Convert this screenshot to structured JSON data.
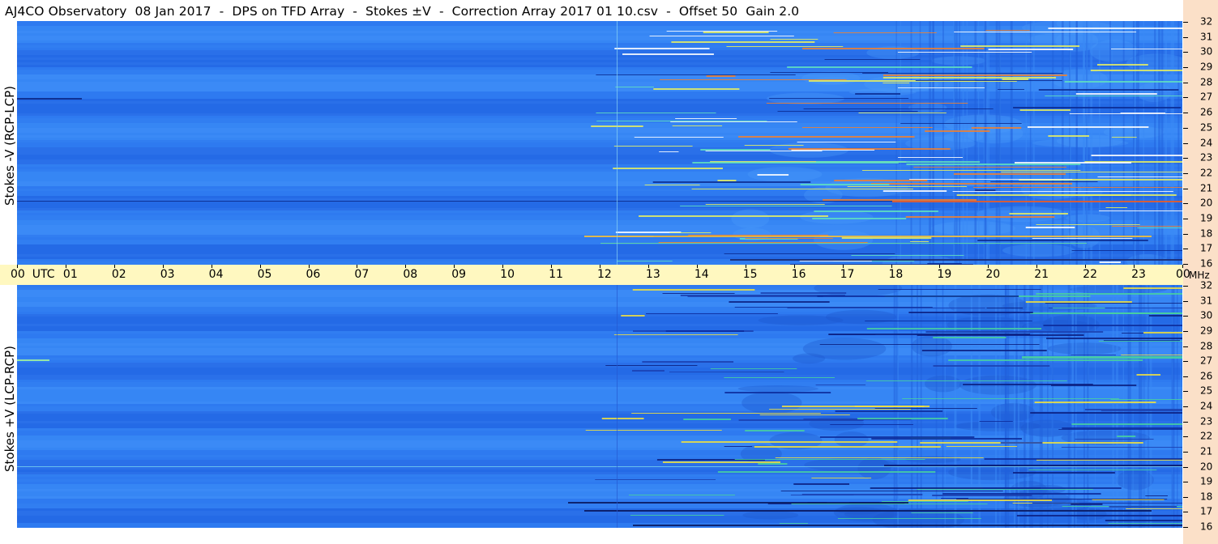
{
  "title": "AJ4CO Observatory  08 Jan 2017  -  DPS on TFD Array  -  Stokes ±V  -  Correction Array 2017 01 10.csv  -  Offset 50  Gain 2.0",
  "panels": {
    "top": {
      "ylabel": "Stokes -V (RCP-LCP)"
    },
    "bottom": {
      "ylabel": "Stokes +V (LCP-RCP)"
    }
  },
  "time_axis": {
    "start_label": "00  UTC",
    "labels": [
      "01",
      "02",
      "03",
      "04",
      "05",
      "06",
      "07",
      "08",
      "09",
      "10",
      "11",
      "12",
      "13",
      "14",
      "15",
      "16",
      "17",
      "18",
      "19",
      "20",
      "21",
      "22",
      "23"
    ],
    "end_label": "00"
  },
  "freq_axis": {
    "unit": "MHz",
    "labels": [
      "32",
      "31",
      "30",
      "29",
      "28",
      "27",
      "26",
      "25",
      "24",
      "23",
      "22",
      "21",
      "20",
      "19",
      "18",
      "17",
      "16"
    ]
  },
  "colors": {
    "background": "#2f7af0",
    "axis_band": "#fff8c0",
    "right_strip": "#fbe0c8"
  },
  "chart_data": {
    "type": "heatmap",
    "xlabel": "UTC",
    "ylabel": "MHz",
    "x_range": [
      0,
      24
    ],
    "y_range": [
      16,
      32
    ],
    "panels": [
      {
        "name": "Stokes -V (RCP-LCP)"
      },
      {
        "name": "Stokes +V (LCP-RCP)"
      }
    ]
  }
}
